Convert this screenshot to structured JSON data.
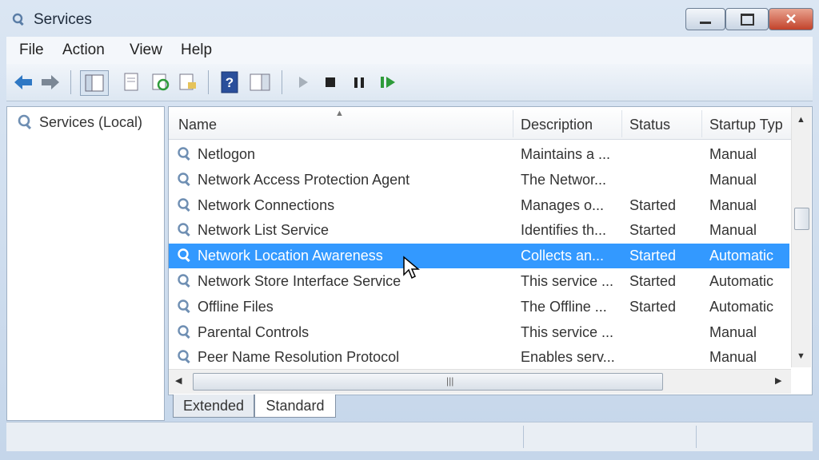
{
  "window": {
    "title": "Services",
    "close_glyph": "✕"
  },
  "menu": [
    "File",
    "Action",
    "View",
    "Help"
  ],
  "toolbar": {
    "icons": [
      "back-arrow-icon",
      "forward-arrow-icon",
      "show-hide-console-tree-icon",
      "properties-icon",
      "refresh-icon",
      "export-list-icon",
      "help-icon",
      "show-action-pane-icon",
      "start-service-icon",
      "stop-service-icon",
      "pause-service-icon",
      "restart-service-icon"
    ]
  },
  "tree": {
    "root_label": "Services (Local)"
  },
  "columns": {
    "name": "Name",
    "description": "Description",
    "status": "Status",
    "startup": "Startup Typ"
  },
  "rows": [
    {
      "name": "Netlogon",
      "description": "Maintains a ...",
      "status": "",
      "startup": "Manual",
      "selected": false
    },
    {
      "name": "Network Access Protection Agent",
      "description": "The Networ...",
      "status": "",
      "startup": "Manual",
      "selected": false
    },
    {
      "name": "Network Connections",
      "description": "Manages o...",
      "status": "Started",
      "startup": "Manual",
      "selected": false
    },
    {
      "name": "Network List Service",
      "description": "Identifies th...",
      "status": "Started",
      "startup": "Manual",
      "selected": false
    },
    {
      "name": "Network Location Awareness",
      "description": "Collects an...",
      "status": "Started",
      "startup": "Automatic",
      "selected": true
    },
    {
      "name": "Network Store Interface Service",
      "description": "This service ...",
      "status": "Started",
      "startup": "Automatic",
      "selected": false
    },
    {
      "name": "Offline Files",
      "description": "The Offline ...",
      "status": "Started",
      "startup": "Automatic",
      "selected": false
    },
    {
      "name": "Parental Controls",
      "description": "This service ...",
      "status": "",
      "startup": "Manual",
      "selected": false
    },
    {
      "name": "Peer Name Resolution Protocol",
      "description": "Enables serv...",
      "status": "",
      "startup": "Manual",
      "selected": false
    }
  ],
  "tabs": {
    "extended": "Extended",
    "standard": "Standard",
    "active": "Standard"
  },
  "colors": {
    "selection": "#3399ff",
    "close": "#c2432b",
    "toolbar_green": "#2e9b3a"
  }
}
